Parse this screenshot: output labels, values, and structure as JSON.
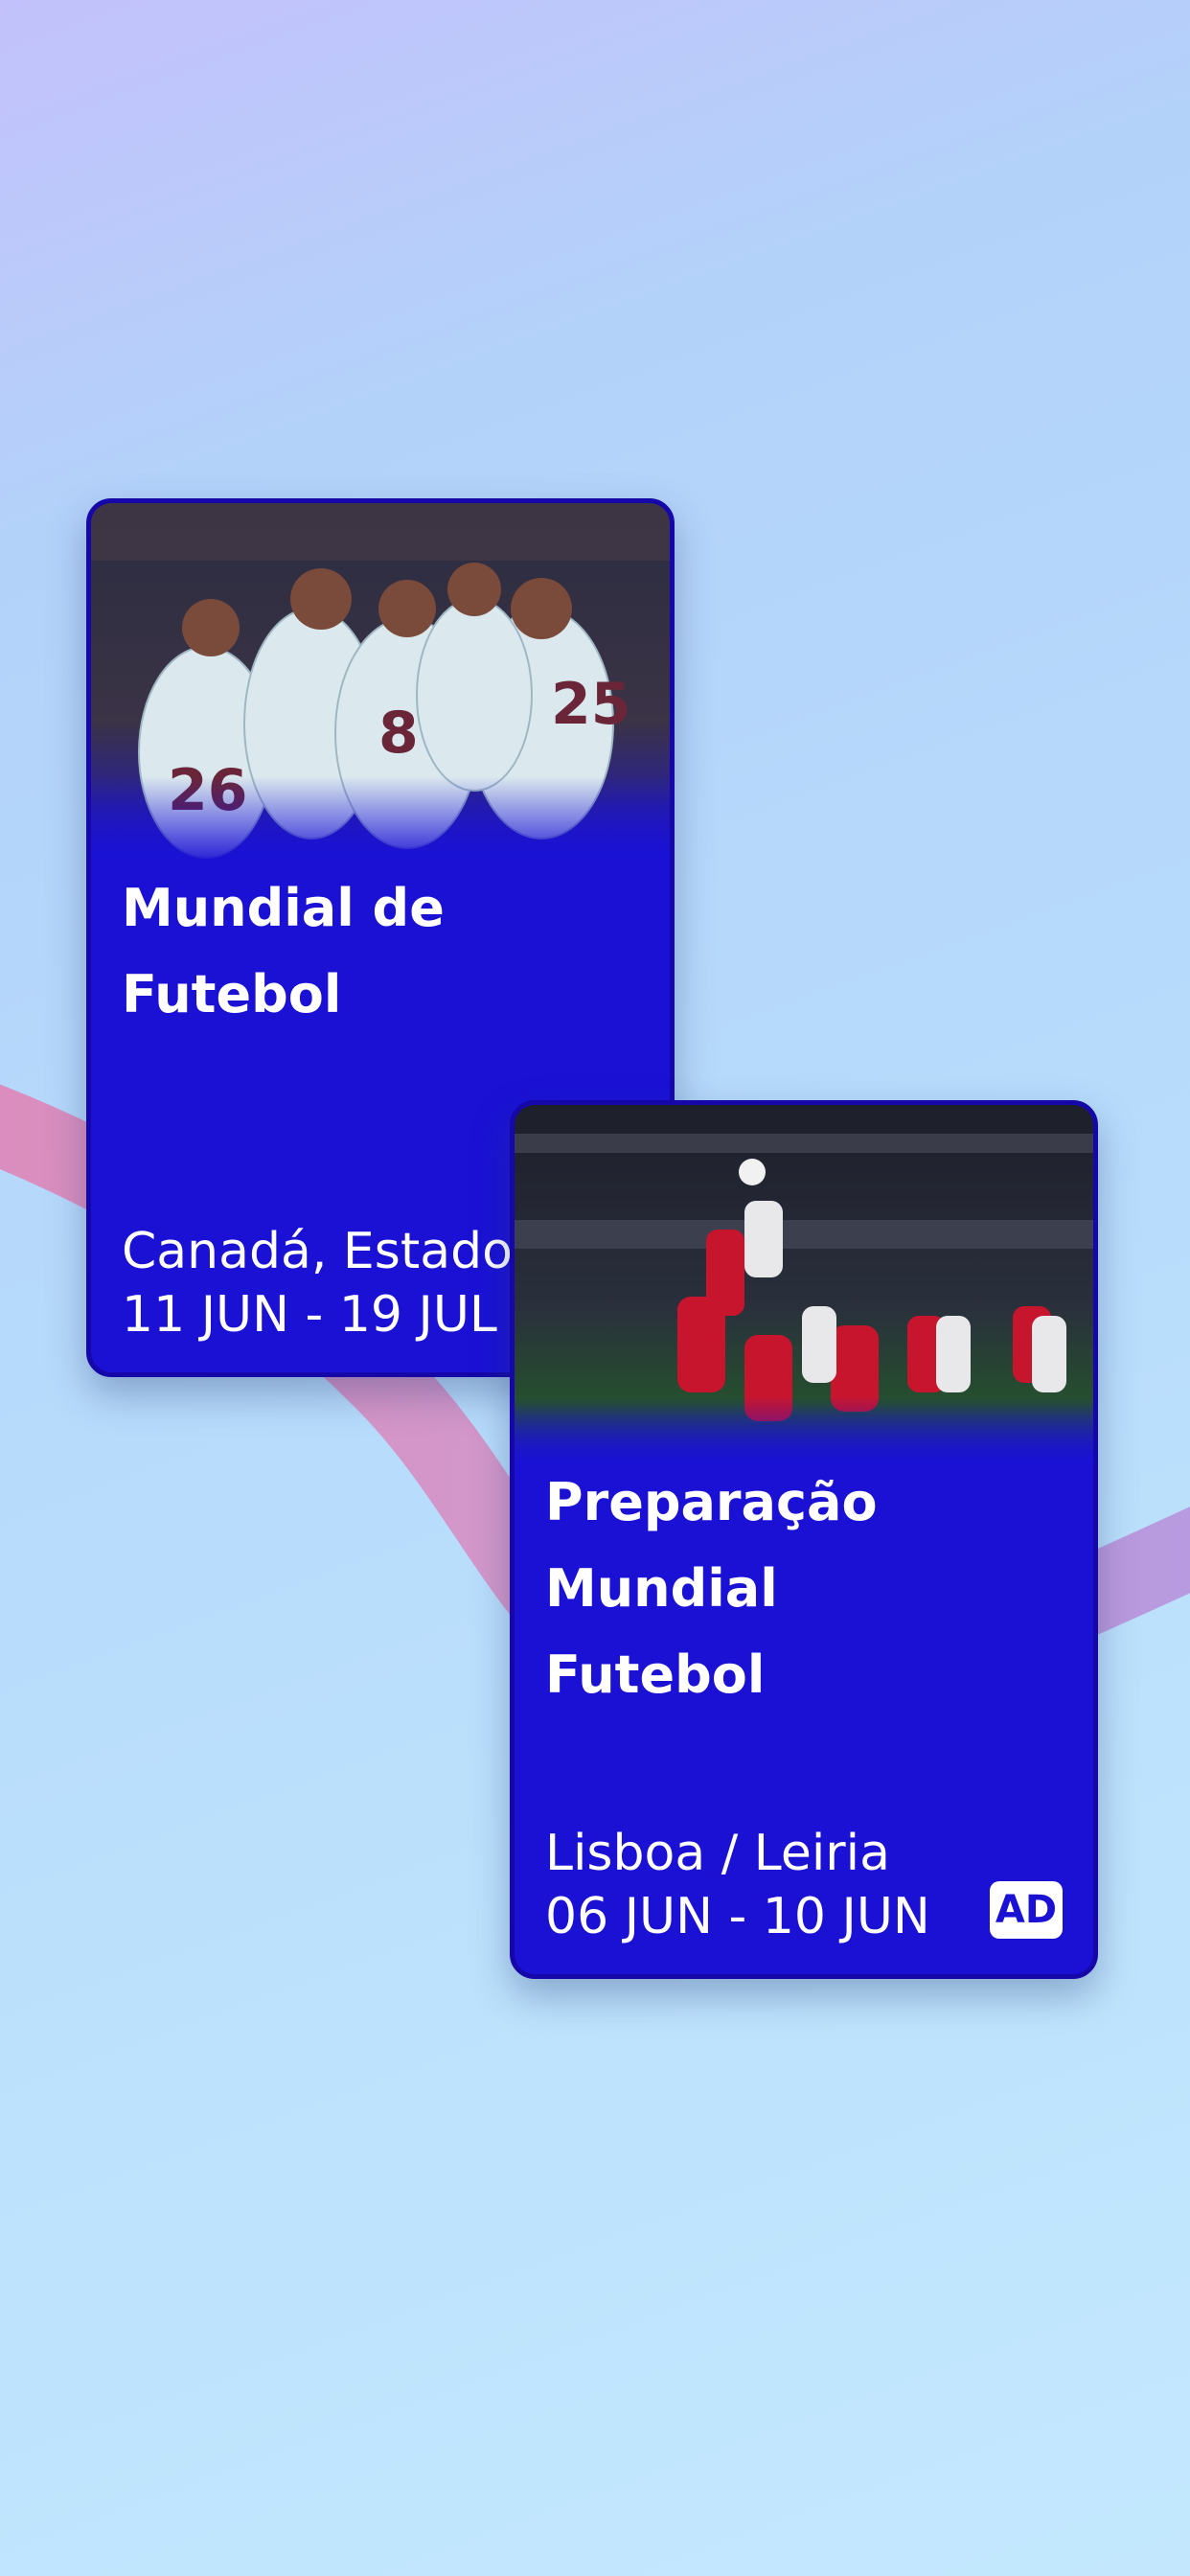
{
  "cards": [
    {
      "title": "Mundial de\nFutebol",
      "location": "Canadá, Estados Unidos e México",
      "dates": "11 JUN - 19 JUL",
      "image": "team-celebration-photo"
    },
    {
      "title": "Preparação\nMundial\nFutebol",
      "location": "Lisboa / Leiria",
      "dates": "06 JUN - 10 JUN",
      "badge": "AD",
      "image": "football-match-header-photo"
    }
  ],
  "colors": {
    "card_background": "#1a11d5",
    "card_border": "#1507a8",
    "ribbon": "#d88fc8",
    "text": "#ffffff"
  }
}
